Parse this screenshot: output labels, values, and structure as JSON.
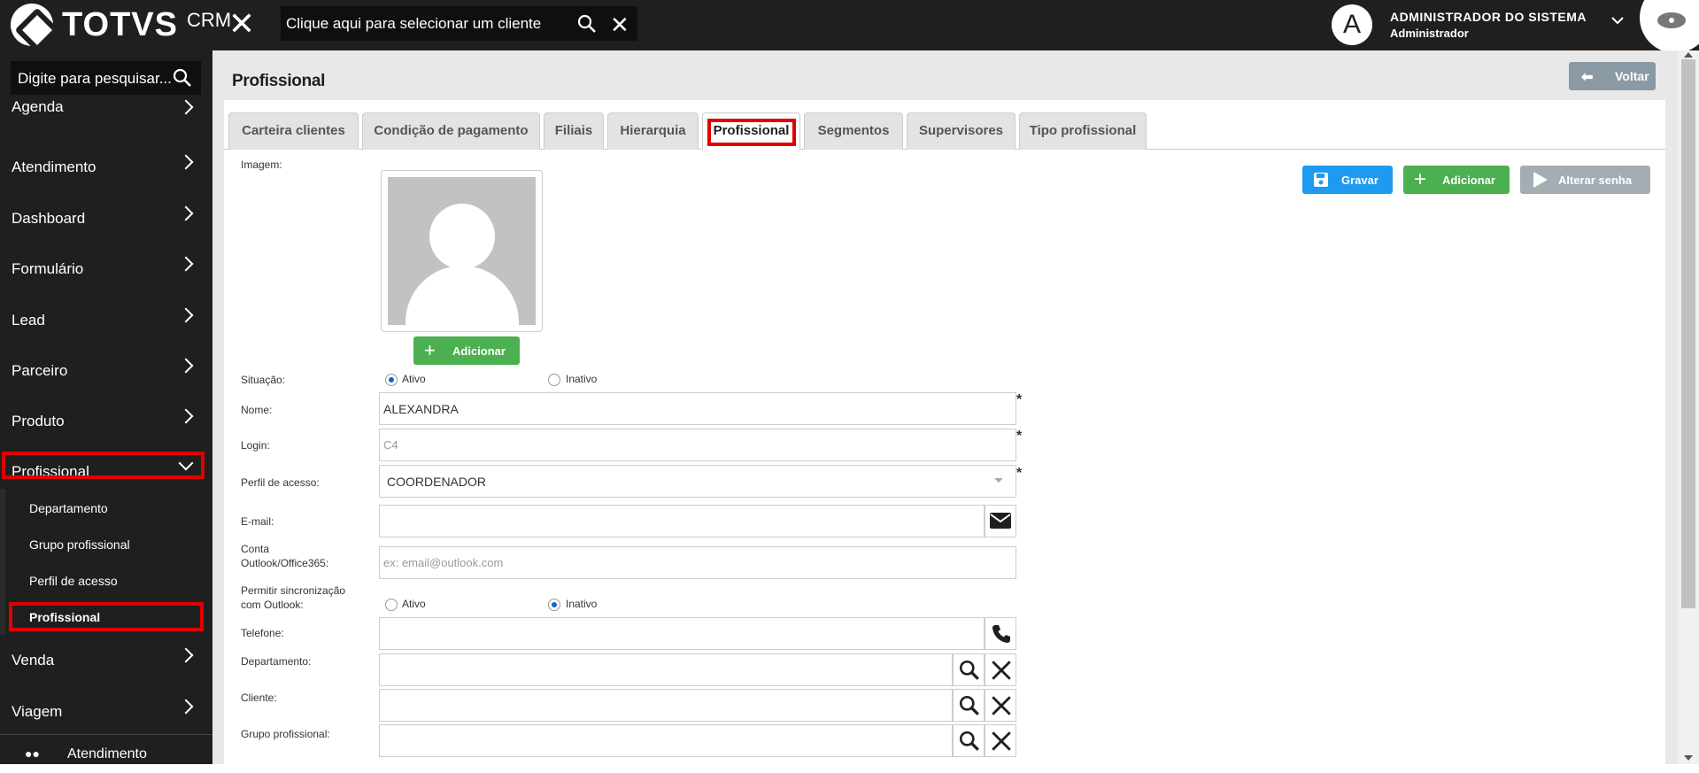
{
  "app": {
    "logo_text": "TOTVS",
    "logo_suffix": "CRM"
  },
  "topbar": {
    "client_search_placeholder": "Clique aqui para selecionar um cliente",
    "user_initial": "A",
    "user_name": "ADMINISTRADOR DO SISTEMA",
    "user_role": "Administrador"
  },
  "sidebar": {
    "search_placeholder": "Digite para pesquisar...",
    "items": [
      {
        "label": "Agenda"
      },
      {
        "label": "Atendimento"
      },
      {
        "label": "Dashboard"
      },
      {
        "label": "Formulário"
      },
      {
        "label": "Lead"
      },
      {
        "label": "Parceiro"
      },
      {
        "label": "Produto"
      },
      {
        "label": "Profissional"
      },
      {
        "label": "Venda"
      },
      {
        "label": "Viagem"
      }
    ],
    "subitems": [
      {
        "label": "Departamento"
      },
      {
        "label": "Grupo profissional"
      },
      {
        "label": "Perfil de acesso"
      },
      {
        "label": "Profissional"
      }
    ],
    "bottom_label": "Atendimento"
  },
  "main": {
    "page_title": "Profissional",
    "back_label": "Voltar",
    "tabs": [
      {
        "label": "Carteira clientes"
      },
      {
        "label": "Condição de pagamento"
      },
      {
        "label": "Filiais"
      },
      {
        "label": "Hierarquia"
      },
      {
        "label": "Profissional"
      },
      {
        "label": "Segmentos"
      },
      {
        "label": "Supervisores"
      },
      {
        "label": "Tipo profissional"
      }
    ],
    "active_tab": "Profissional",
    "buttons": {
      "save": "Gravar",
      "add": "Adicionar",
      "change_password": "Alterar senha",
      "add_photo": "Adicionar"
    },
    "form": {
      "image_label": "Imagem:",
      "status_label": "Situação:",
      "status_active": "Ativo",
      "status_inactive": "Inativo",
      "name_label": "Nome:",
      "name_value": "ALEXANDRA",
      "login_label": "Login:",
      "login_value": "C4",
      "profile_label": "Perfil de acesso:",
      "profile_value": "COORDENADOR",
      "email_label": "E-mail:",
      "email_value": "",
      "outlook_label_1": "Conta",
      "outlook_label_2": "Outlook/Office365:",
      "outlook_placeholder": "ex: email@outlook.com",
      "sync_label_1": "Permitir sincronização",
      "sync_label_2": "com Outlook:",
      "sync_active": "Ativo",
      "sync_inactive": "Inativo",
      "phone_label": "Telefone:",
      "phone_value": "",
      "department_label": "Departamento:",
      "client_label": "Cliente:",
      "group_label": "Grupo profissional:",
      "required_mark": "*"
    }
  },
  "colors": {
    "save": "#1e9bf0",
    "add": "#4caf50",
    "disabled": "#a3adb3",
    "highlight": "#e00000",
    "sidebar_bg": "#1f1f1f"
  }
}
